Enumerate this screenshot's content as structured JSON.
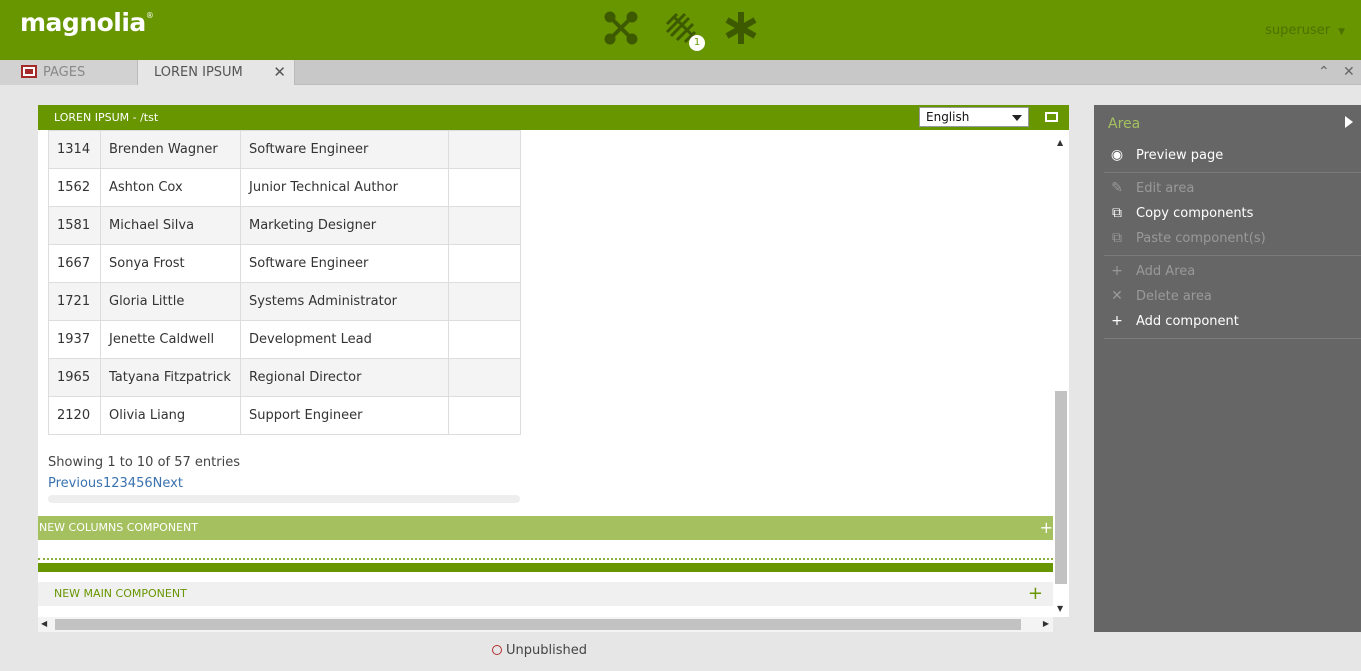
{
  "header": {
    "logo": "magnolia",
    "logo_mark": "®",
    "notification_count": "1",
    "user": "superuser",
    "app_icons": [
      "apps-launcher-icon",
      "pulse-icon",
      "favorites-icon"
    ],
    "brand_color": "#689600"
  },
  "tabs": [
    {
      "label": "PAGES",
      "icon": "pages-icon",
      "active": false
    },
    {
      "label": "LOREN IPSUM",
      "active": true
    }
  ],
  "editor": {
    "title": "LOREN IPSUM - /tst",
    "language": "English",
    "table": {
      "rows": [
        {
          "id": "1314",
          "name": "Brenden Wagner",
          "position": "Software Engineer"
        },
        {
          "id": "1562",
          "name": "Ashton Cox",
          "position": "Junior Technical Author"
        },
        {
          "id": "1581",
          "name": "Michael Silva",
          "position": "Marketing Designer"
        },
        {
          "id": "1667",
          "name": "Sonya Frost",
          "position": "Software Engineer"
        },
        {
          "id": "1721",
          "name": "Gloria Little",
          "position": "Systems Administrator"
        },
        {
          "id": "1937",
          "name": "Jenette Caldwell",
          "position": "Development Lead"
        },
        {
          "id": "1965",
          "name": "Tatyana Fitzpatrick",
          "position": "Regional Director"
        },
        {
          "id": "2120",
          "name": "Olivia Liang",
          "position": "Support Engineer"
        }
      ]
    },
    "showing": "Showing 1 to 10 of 57 entries",
    "pager": {
      "previous": "Previous",
      "pages": [
        "1",
        "2",
        "3",
        "4",
        "5",
        "6"
      ],
      "next": "Next"
    },
    "new_columns_label": "NEW COLUMNS COMPONENT",
    "new_main_label": "NEW MAIN COMPONENT",
    "plus": "+"
  },
  "status": "Unpublished",
  "actionbar": {
    "title": "Area",
    "items": [
      {
        "label": "Preview page",
        "icon": "eye-icon",
        "enabled": true
      },
      {
        "label": "Edit area",
        "icon": "pencil-icon",
        "enabled": false
      },
      {
        "label": "Copy components",
        "icon": "copy-icon",
        "enabled": true
      },
      {
        "label": "Paste component(s)",
        "icon": "paste-icon",
        "enabled": false
      },
      {
        "label": "Add Area",
        "icon": "plus-icon",
        "enabled": false
      },
      {
        "label": "Delete area",
        "icon": "close-icon",
        "enabled": false
      },
      {
        "label": "Add component",
        "icon": "plus-icon",
        "enabled": true
      }
    ]
  }
}
